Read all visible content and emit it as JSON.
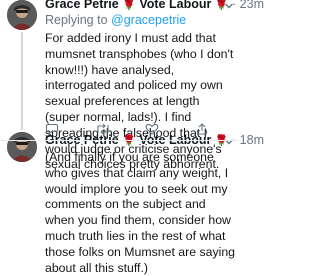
{
  "tweets": [
    {
      "display_name": "Grace Petrie",
      "vote_label": "Vote Labour",
      "rose_icon": "rose-emoji",
      "time": "23m",
      "replying_prefix": "Replying to",
      "replying_handle": "@gracepetrie",
      "text": "For added irony I must add that mumsnet transphobes (who I don't know!!!) have analysed, interrogated and policed my own sexual preferences at length (super normal, lads!). I find spreading the falsehood that I would judge or criticise anyone's sexual choices pretty abhorrent."
    },
    {
      "display_name": "Grace Petrie",
      "vote_label": "Vote Labour",
      "rose_icon": "rose-emoji",
      "time": "18m",
      "text": "(And finally if you are someone who gives that claim any weight, I would implore you to seek out my comments on the subject and when you find them, consider how much truth lies in the rest of what those folks on Mumsnet are saying about all this stuff.)"
    }
  ],
  "colors": {
    "link": "#1da1f2",
    "muted": "#657786",
    "rose": "#e0245e"
  }
}
